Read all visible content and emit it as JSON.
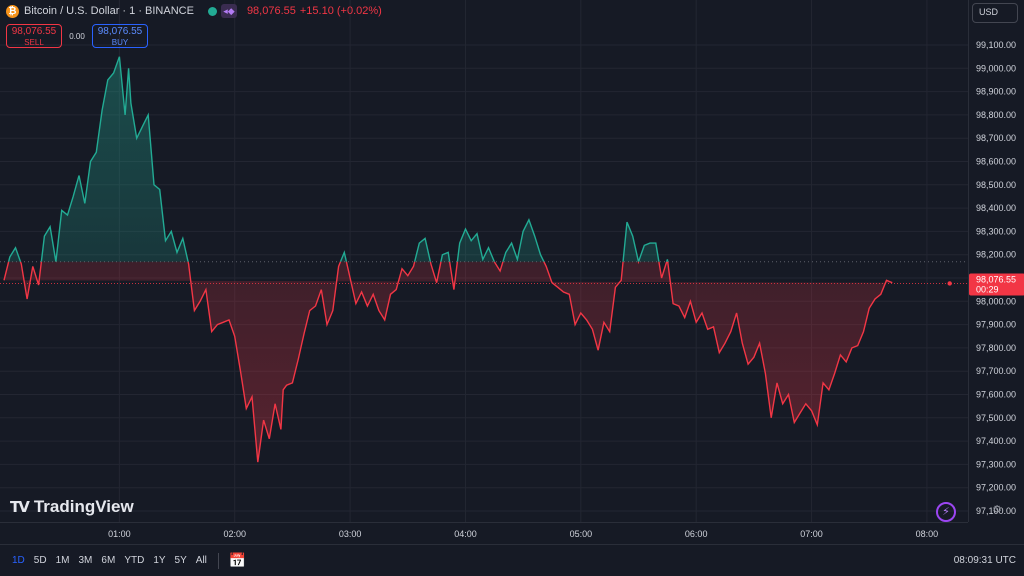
{
  "legend": {
    "symbol": "Bitcoin / U.S. Dollar · 1 · BINANCE",
    "last": "98,076.55",
    "change": "+15.10 (+0.02%)"
  },
  "trade": {
    "sell_price": "98,076.55",
    "sell_label": "SELL",
    "spread": "0.00",
    "buy_price": "98,076.55",
    "buy_label": "BUY"
  },
  "currency": "USD",
  "logo": "TradingView",
  "price_label": {
    "price": "98,076.55",
    "countdown": "00:29"
  },
  "ranges": [
    "1D",
    "5D",
    "1M",
    "3M",
    "6M",
    "YTD",
    "1Y",
    "5Y",
    "All"
  ],
  "active_range": "1D",
  "clock": "08:09:31 UTC",
  "colors": {
    "up": "#22ab94",
    "down": "#f23645",
    "background": "#161a25",
    "grid": "#232632"
  },
  "chart_data": {
    "type": "area",
    "baseline": 98170,
    "last_price": 98076.55,
    "ylim": [
      97050,
      99200
    ],
    "xlim": [
      0.0,
      8.2
    ],
    "y_ticks": [
      "97,100.00",
      "97,200.00",
      "97,300.00",
      "97,400.00",
      "97,500.00",
      "97,600.00",
      "97,700.00",
      "97,800.00",
      "97,900.00",
      "98,000.00",
      "98,100.00",
      "98,200.00",
      "98,300.00",
      "98,400.00",
      "98,500.00",
      "98,600.00",
      "98,700.00",
      "98,800.00",
      "98,900.00",
      "99,000.00",
      "99,100.00"
    ],
    "y_tick_values": [
      97100,
      97200,
      97300,
      97400,
      97500,
      97600,
      97700,
      97800,
      97900,
      98000,
      98100,
      98200,
      98300,
      98400,
      98500,
      98600,
      98700,
      98800,
      98900,
      99000,
      99100
    ],
    "x_ticks": [
      "01:00",
      "02:00",
      "03:00",
      "04:00",
      "05:00",
      "06:00",
      "07:00",
      "08:00"
    ],
    "x_tick_values": [
      1,
      2,
      3,
      4,
      5,
      6,
      7,
      8
    ],
    "x": [
      0.0,
      0.05,
      0.1,
      0.15,
      0.2,
      0.25,
      0.3,
      0.35,
      0.4,
      0.45,
      0.5,
      0.55,
      0.6,
      0.65,
      0.7,
      0.75,
      0.8,
      0.85,
      0.9,
      0.95,
      1.0,
      1.05,
      1.08,
      1.1,
      1.15,
      1.2,
      1.25,
      1.3,
      1.35,
      1.4,
      1.45,
      1.5,
      1.55,
      1.6,
      1.65,
      1.7,
      1.75,
      1.8,
      1.85,
      1.9,
      1.95,
      2.0,
      2.05,
      2.1,
      2.15,
      2.2,
      2.25,
      2.3,
      2.35,
      2.4,
      2.42,
      2.45,
      2.5,
      2.55,
      2.6,
      2.65,
      2.7,
      2.75,
      2.8,
      2.85,
      2.9,
      2.95,
      3.0,
      3.05,
      3.1,
      3.15,
      3.2,
      3.25,
      3.3,
      3.35,
      3.4,
      3.45,
      3.5,
      3.55,
      3.6,
      3.65,
      3.7,
      3.75,
      3.8,
      3.85,
      3.9,
      3.95,
      4.0,
      4.05,
      4.1,
      4.15,
      4.2,
      4.25,
      4.3,
      4.35,
      4.4,
      4.45,
      4.5,
      4.55,
      4.6,
      4.65,
      4.7,
      4.75,
      4.8,
      4.85,
      4.9,
      4.95,
      5.0,
      5.05,
      5.1,
      5.15,
      5.2,
      5.25,
      5.3,
      5.35,
      5.4,
      5.45,
      5.5,
      5.55,
      5.6,
      5.65,
      5.7,
      5.75,
      5.8,
      5.85,
      5.9,
      5.95,
      6.0,
      6.05,
      6.1,
      6.15,
      6.2,
      6.25,
      6.3,
      6.35,
      6.4,
      6.45,
      6.5,
      6.55,
      6.6,
      6.65,
      6.7,
      6.75,
      6.8,
      6.85,
      6.9,
      6.95,
      7.0,
      7.05,
      7.1,
      7.15,
      7.2,
      7.25,
      7.3,
      7.35,
      7.4,
      7.45,
      7.5,
      7.55,
      7.6,
      7.65,
      7.7,
      7.75,
      7.8,
      7.85,
      7.9,
      7.95,
      8.0,
      8.05,
      8.1,
      8.15,
      8.18
    ],
    "y": [
      98090,
      98190,
      98230,
      98160,
      98010,
      98150,
      98070,
      98280,
      98320,
      98170,
      98390,
      98370,
      98450,
      98540,
      98420,
      98600,
      98640,
      98820,
      98950,
      98980,
      99050,
      98800,
      99000,
      98850,
      98700,
      98750,
      98800,
      98500,
      98480,
      98260,
      98300,
      98210,
      98270,
      98160,
      97960,
      98000,
      98050,
      97870,
      97900,
      97910,
      97920,
      97850,
      97700,
      97540,
      97590,
      97310,
      97490,
      97410,
      97560,
      97450,
      97620,
      97640,
      97650,
      97750,
      97860,
      97960,
      97980,
      98050,
      97900,
      97960,
      98150,
      98210,
      98100,
      97990,
      98040,
      97980,
      98030,
      97960,
      97920,
      98030,
      98050,
      98140,
      98110,
      98150,
      98250,
      98270,
      98160,
      98080,
      98200,
      98210,
      98050,
      98250,
      98310,
      98260,
      98290,
      98180,
      98230,
      98170,
      98130,
      98210,
      98250,
      98180,
      98300,
      98350,
      98280,
      98200,
      98150,
      98080,
      98060,
      98040,
      98030,
      97900,
      97950,
      97920,
      97880,
      97790,
      97910,
      97870,
      98060,
      98090,
      98340,
      98280,
      98170,
      98240,
      98250,
      98250,
      98100,
      98180,
      97990,
      97980,
      97930,
      98000,
      97910,
      97950,
      97880,
      97890,
      97780,
      97820,
      97870,
      97950,
      97820,
      97730,
      97760,
      97820,
      97690,
      97500,
      97650,
      97560,
      97600,
      97480,
      97520,
      97560,
      97530,
      97470,
      97650,
      97620,
      97690,
      97770,
      97740,
      97800,
      97810,
      97870,
      97970,
      98010,
      98030,
      98090,
      98080
    ]
  }
}
